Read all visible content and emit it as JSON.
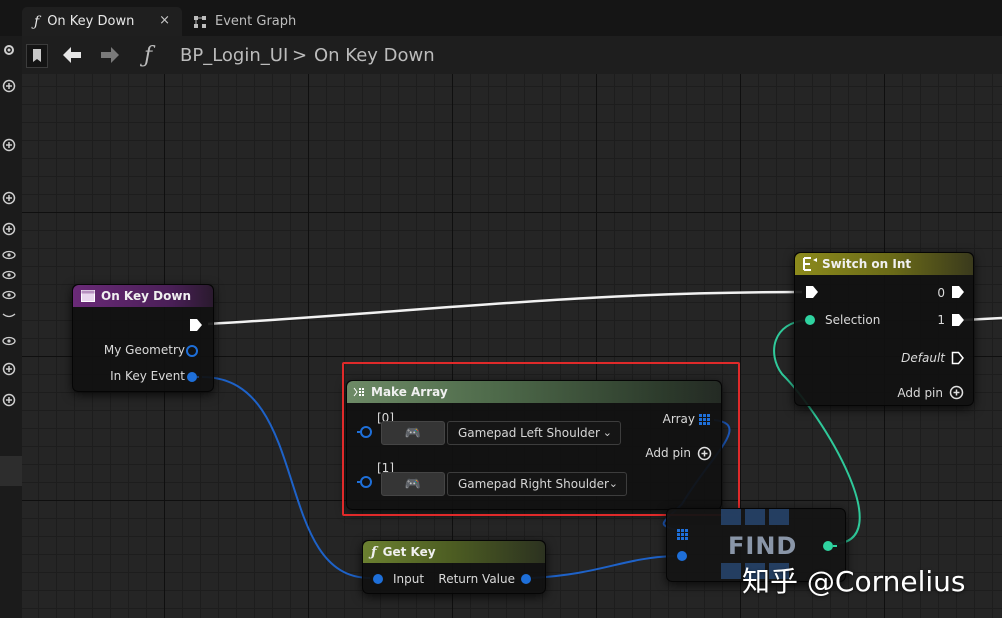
{
  "tabs": [
    {
      "glyph": "ƒ",
      "label": "On Key Down",
      "close": "×"
    },
    {
      "label": "Event Graph"
    }
  ],
  "breadcrumb": {
    "function_glyph": "ƒ",
    "blueprint": "BP_Login_UI",
    "separator": ">",
    "current": "On Key Down"
  },
  "nodes": {
    "on_key_down": {
      "title": "On Key Down",
      "pins": {
        "geometry": "My Geometry",
        "key_event": "In Key Event"
      }
    },
    "make_array": {
      "title": "Make Array",
      "index0": "[0]",
      "index1": "[1]",
      "value0": "Gamepad Left Shoulder",
      "value1": "Gamepad Right Shoulder",
      "output": "Array",
      "add_pin": "Add pin"
    },
    "get_key": {
      "title": "Get Key",
      "input": "Input",
      "output": "Return Value"
    },
    "switch_on_int": {
      "title": "Switch on Int",
      "selection": "Selection",
      "out0": "0",
      "out1": "1",
      "default": "Default",
      "add_pin": "Add pin"
    },
    "find": {
      "title": "FIND"
    }
  },
  "watermark": "知乎 @Cornelius",
  "colors": {
    "on_key_down_header": "#6a2a78",
    "make_array_header": "#4e6a4a",
    "get_key_header": "#5b6e2a",
    "switch_header": "#7b7a1c",
    "struct_pin": "#1e6fd9",
    "int_pin": "#2fd3a0",
    "highlight": "#e02a2a"
  }
}
